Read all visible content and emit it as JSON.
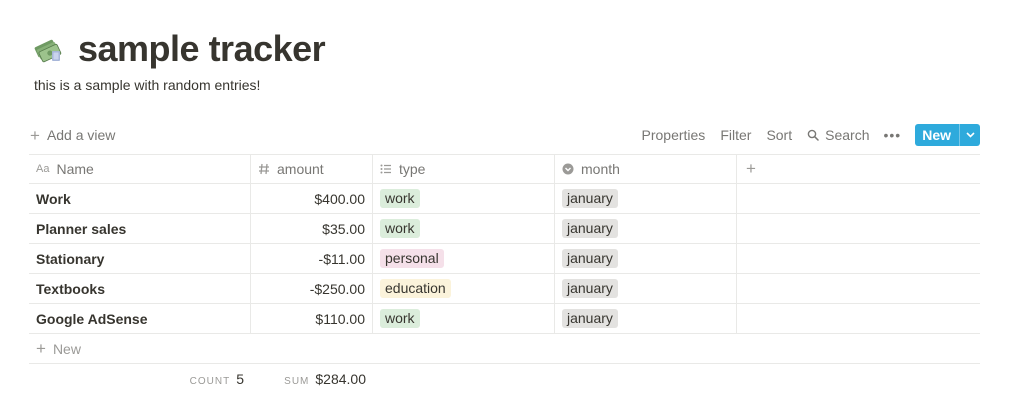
{
  "page": {
    "icon": "money-stack-icon",
    "title": "sample tracker",
    "description": "this is a sample with random entries!"
  },
  "toolbar": {
    "add_view": "Add a view",
    "properties": "Properties",
    "filter": "Filter",
    "sort": "Sort",
    "search": "Search",
    "more": "more-horizontal-icon",
    "new": "New"
  },
  "colors": {
    "accent": "#2eaadc",
    "tag_work": "#dbeddb",
    "tag_personal": "#f5e0e9",
    "tag_education": "#fbf3db",
    "tag_month": "#e3e2e0"
  },
  "columns": [
    {
      "label": "Name",
      "icon": "text-property-icon"
    },
    {
      "label": "amount",
      "icon": "number-property-icon"
    },
    {
      "label": "type",
      "icon": "multi-select-property-icon"
    },
    {
      "label": "month",
      "icon": "select-property-icon"
    }
  ],
  "rows": [
    {
      "name": "Work",
      "amount": "$400.00",
      "type": "work",
      "month": "january"
    },
    {
      "name": "Planner sales",
      "amount": "$35.00",
      "type": "work",
      "month": "january"
    },
    {
      "name": "Stationary",
      "amount": "-$11.00",
      "type": "personal",
      "month": "january"
    },
    {
      "name": "Textbooks",
      "amount": "-$250.00",
      "type": "education",
      "month": "january"
    },
    {
      "name": "Google AdSense",
      "amount": "$110.00",
      "type": "work",
      "month": "january"
    }
  ],
  "new_row_label": "New",
  "footer": {
    "count_label": "COUNT",
    "count_value": "5",
    "sum_label": "SUM",
    "sum_value": "$284.00"
  }
}
